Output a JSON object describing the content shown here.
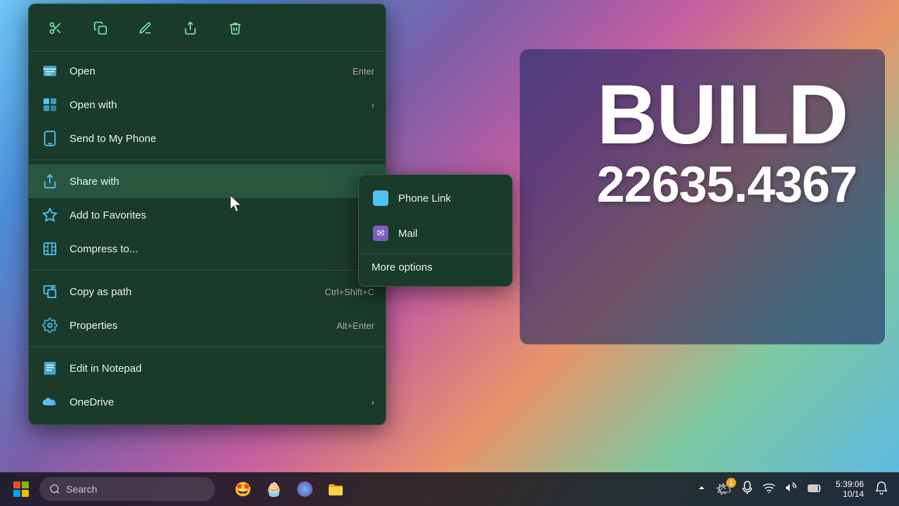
{
  "desktop": {
    "build_label": "BUILD",
    "build_number": "22635.4367"
  },
  "context_menu": {
    "toolbar": {
      "cut_label": "✂",
      "copy_label": "⧉",
      "rename_label": "✎",
      "share_label": "↗",
      "delete_label": "🗑"
    },
    "items": [
      {
        "id": "open",
        "icon": "📋",
        "label": "Open",
        "shortcut": "Enter",
        "has_arrow": false
      },
      {
        "id": "open-with",
        "icon": "⊞",
        "label": "Open with",
        "shortcut": "",
        "has_arrow": true
      },
      {
        "id": "send-to-phone",
        "icon": "📱",
        "label": "Send to My Phone",
        "shortcut": "",
        "has_arrow": false
      },
      {
        "id": "share-with",
        "icon": "↗",
        "label": "Share with",
        "shortcut": "",
        "has_arrow": true,
        "active": true
      },
      {
        "id": "add-favorites",
        "icon": "☆",
        "label": "Add to Favorites",
        "shortcut": "",
        "has_arrow": false
      },
      {
        "id": "compress",
        "icon": "🗜",
        "label": "Compress to...",
        "shortcut": "",
        "has_arrow": true
      },
      {
        "id": "copy-path",
        "icon": "⬛",
        "label": "Copy as path",
        "shortcut": "Ctrl+Shift+C",
        "has_arrow": false
      },
      {
        "id": "properties",
        "icon": "🔧",
        "label": "Properties",
        "shortcut": "Alt+Enter",
        "has_arrow": false
      },
      {
        "id": "edit-notepad",
        "icon": "📋",
        "label": "Edit in Notepad",
        "shortcut": "",
        "has_arrow": false
      },
      {
        "id": "onedrive",
        "icon": "☁",
        "label": "OneDrive",
        "shortcut": "",
        "has_arrow": true
      }
    ]
  },
  "submenu": {
    "items": [
      {
        "id": "phone-link",
        "label": "Phone Link",
        "icon_type": "phone-link"
      },
      {
        "id": "mail",
        "label": "Mail",
        "icon_type": "mail"
      }
    ],
    "more_options": "More options"
  },
  "taskbar": {
    "search_placeholder": "Search",
    "clock_time": "5:39:06",
    "clock_date": "10/14",
    "notification_count": "1",
    "apps": [
      "🤩",
      "🧁"
    ]
  }
}
